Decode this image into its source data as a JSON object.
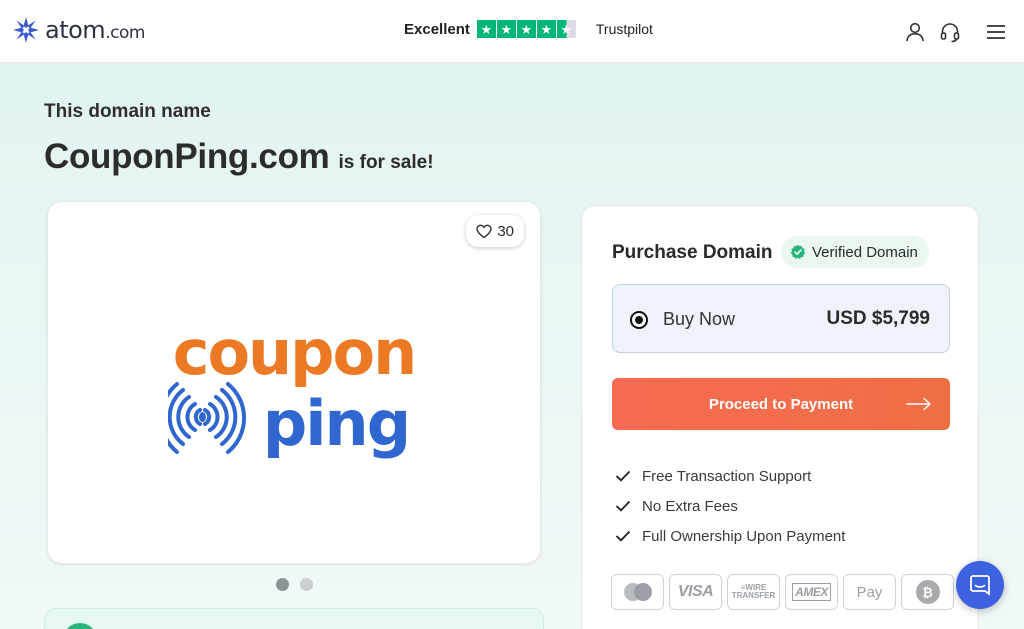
{
  "header": {
    "logo": {
      "name": "atom",
      "tld": ".com"
    },
    "trustpilot": {
      "label": "Excellent",
      "rating_stars": 4.5,
      "brand": "Trustpilot"
    },
    "icons": [
      "user-icon",
      "headset-icon",
      "menu-icon"
    ]
  },
  "hero": {
    "eyebrow": "This domain name",
    "domain": "CouponPing.com",
    "suffix": "is for sale!"
  },
  "listing": {
    "likes": "30",
    "logo_words": [
      "coupon",
      "ping"
    ],
    "carousel_total": 2,
    "carousel_active": 1
  },
  "purchase": {
    "title": "Purchase Domain",
    "verified_label": "Verified Domain",
    "option_label": "Buy Now",
    "price": "USD $5,799",
    "cta": "Proceed to Payment",
    "features": [
      "Free Transaction Support",
      "No Extra Fees",
      "Full Ownership Upon Payment"
    ],
    "payment_methods": [
      "Mastercard",
      "VISA",
      "Wire Transfer",
      "AMEX",
      "Apple Pay",
      "Bitcoin"
    ]
  },
  "colors": {
    "brand_navy": "#2c3444",
    "trustpilot_green": "#00b67a",
    "cta_orange": "#f76a52",
    "verified_green": "#26b57a",
    "logo_orange": "#ec7a24",
    "logo_blue": "#2f66d0",
    "chat_blue": "#3d62e0"
  }
}
